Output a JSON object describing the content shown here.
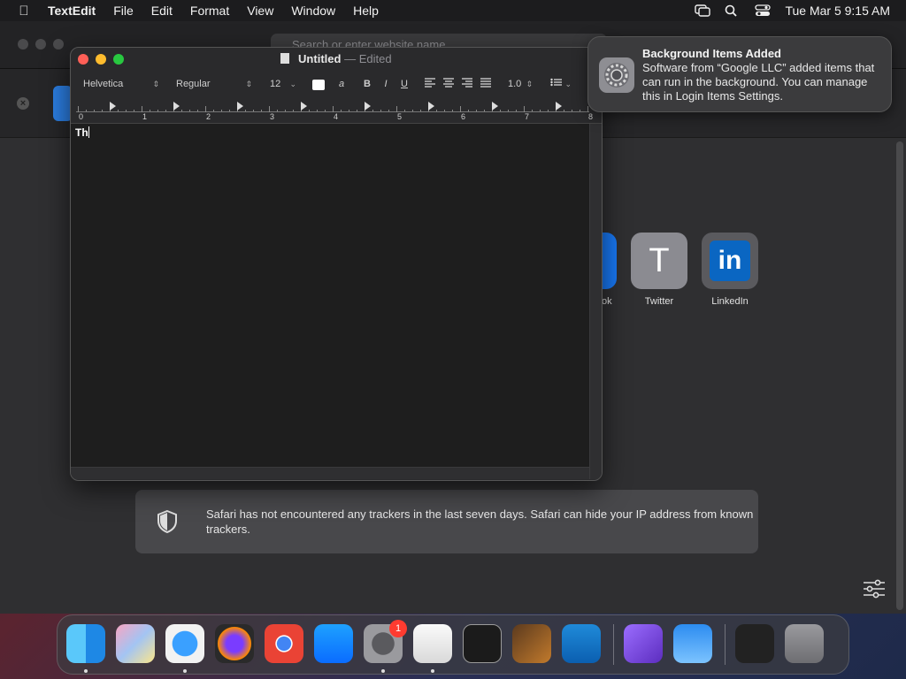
{
  "menubar": {
    "app_name": "TextEdit",
    "items": [
      "File",
      "Edit",
      "Format",
      "View",
      "Window",
      "Help"
    ],
    "clock": "Tue Mar 5  9:15 AM",
    "status_icons": [
      "screen-mirroring-icon",
      "search-icon",
      "control-center-icon"
    ]
  },
  "safari": {
    "address_placeholder": "Search or enter website name",
    "favorites": [
      {
        "label": "Twitter",
        "glyph": "T"
      },
      {
        "label": "LinkedIn",
        "glyph": "in"
      }
    ],
    "partial_favorite_label": "ok",
    "privacy_report": "Safari has not encountered any trackers in the last seven days. Safari can hide your IP address from known trackers."
  },
  "notification": {
    "title": "Background Items Added",
    "body": "Software from “Google LLC” added items that can run in the background. You can manage this in Login Items Settings."
  },
  "textedit": {
    "title": "Untitled",
    "title_separator": "—",
    "status": "Edited",
    "font_family": "Helvetica",
    "font_style": "Regular",
    "font_size": "12",
    "bold_label": "B",
    "italic_label": "I",
    "underline_label": "U",
    "highlight_label": "a",
    "line_spacing": "1.0",
    "ruler_numbers": [
      "0",
      "1",
      "2",
      "3",
      "4",
      "5",
      "6",
      "7",
      "8"
    ],
    "document_text": "Th"
  },
  "dock": {
    "apps": [
      "Finder",
      "Launchpad",
      "Safari",
      "Firefox",
      "Chrome",
      "App Store",
      "System Settings",
      "TextEdit",
      "Terminal",
      "GarageBand",
      "Visual Studio Code",
      "Visual Studio",
      "Weather",
      "Screenshot",
      "Trash"
    ],
    "system_settings_badge": "1"
  }
}
